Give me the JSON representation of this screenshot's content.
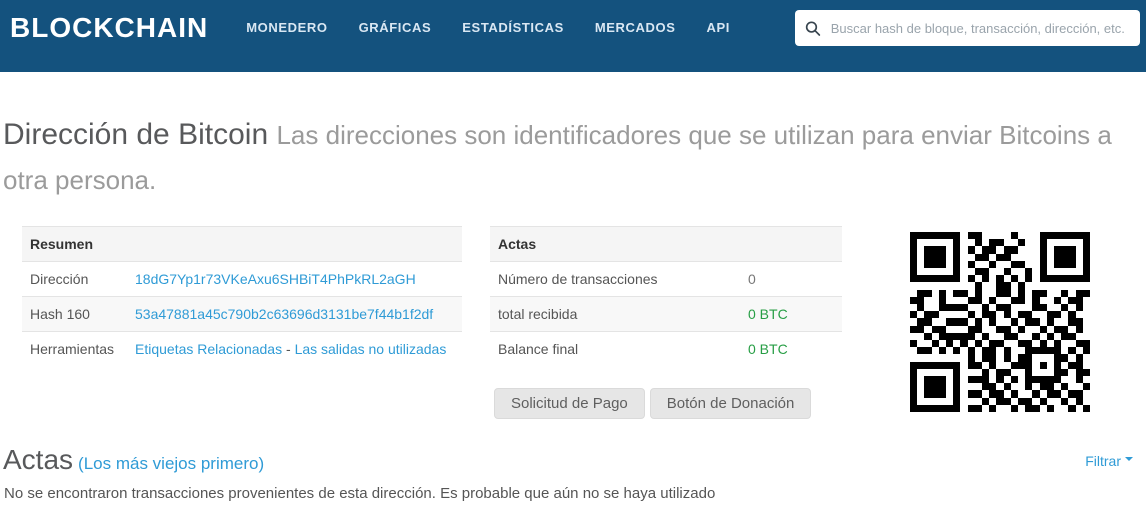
{
  "navbar": {
    "logo": "BLOCKCHAIN",
    "items": [
      {
        "label": "MONEDERO"
      },
      {
        "label": "GRÁFICAS"
      },
      {
        "label": "ESTADÍSTICAS"
      },
      {
        "label": "MERCADOS"
      },
      {
        "label": "API"
      }
    ],
    "search_placeholder": "Buscar hash de bloque, transacción, dirección, etc."
  },
  "page": {
    "title": "Dirección de Bitcoin",
    "subtitle": "Las direcciones son identificadores que se utilizan para enviar Bitcoins a otra persona."
  },
  "summary": {
    "header": "Resumen",
    "rows": [
      {
        "label": "Dirección",
        "value": "18dG7Yp1r73VKeAxu6SHBiT4PhPkRL2aGH"
      },
      {
        "label": "Hash 160",
        "value": "53a47881a45c790b2c63696d3131be7f44b1f2df"
      },
      {
        "label": "Herramientas",
        "link1": "Etiquetas Relacionadas",
        "separator": " - ",
        "link2": "Las salidas no utilizadas"
      }
    ]
  },
  "transactions_summary": {
    "header": "Actas",
    "rows": [
      {
        "label": "Número de transacciones",
        "value": "0"
      },
      {
        "label": "total recibida",
        "value": "0 BTC"
      },
      {
        "label": "Balance final",
        "value": "0 BTC"
      }
    ],
    "buttons": [
      {
        "label": "Solicitud de Pago"
      },
      {
        "label": "Botón de Donación"
      }
    ]
  },
  "qr": {
    "matrix": [
      "1111111011000010001111111",
      "1000001001011001001000001",
      "1011101010110110001011101",
      "1011101001101100001011101",
      "1011101010010011001011101",
      "1000001001100100101000001",
      "1111111010101010101111111",
      "0000000001001101000000000",
      "0110101101001101011001011",
      "1100100011010011010010110",
      "0100111100101100011001010",
      "1011000010110101100110100",
      "0110011101010010110100110",
      "1101100011001101001011010",
      "0010111110100110010101100",
      "1001010101011001101010011",
      "0110101010110100111110101",
      "0000000010110101100011010",
      "1111111011010011101010110",
      "1000001000101100100011011",
      "1011101011101010111110010",
      "1011101000110100101101001",
      "1011101011011010010110110",
      "1000001000101101101001010",
      "1111111011010010110100101"
    ]
  },
  "transactions_section": {
    "heading": "Actas",
    "heading_link": "(Los más viejos primero)",
    "filter_label": "Filtrar",
    "empty_message": "No se encontraron transacciones provenientes de esta dirección. Es probable que aún no se haya utilizado"
  },
  "colors": {
    "navbar_bg": "#14527E",
    "link_blue": "#2F9BD6",
    "success_green": "#279E45",
    "title_gray": "#58595b",
    "subtitle_gray": "#9b9b9b"
  }
}
